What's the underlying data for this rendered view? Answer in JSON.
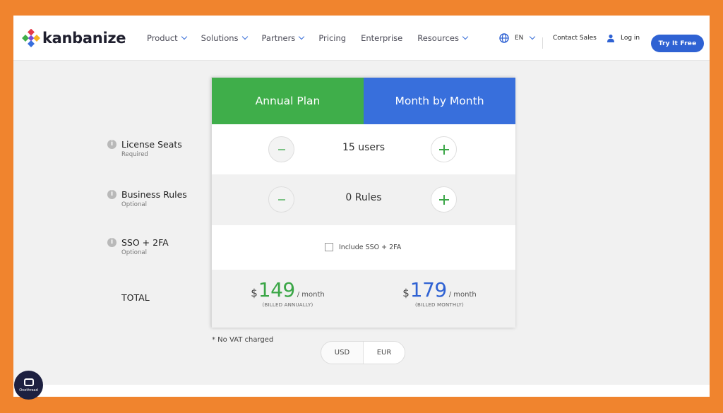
{
  "nav": {
    "logo_text": "kanbanize",
    "menu": [
      {
        "label": "Product",
        "dropdown": true
      },
      {
        "label": "Solutions",
        "dropdown": true
      },
      {
        "label": "Partners",
        "dropdown": true
      },
      {
        "label": "Pricing",
        "dropdown": false
      },
      {
        "label": "Enterprise",
        "dropdown": false
      },
      {
        "label": "Resources",
        "dropdown": true
      }
    ],
    "language": "EN",
    "contact_sales": "Contact Sales",
    "login": "Log in",
    "try_free": "Try It Free"
  },
  "pricing": {
    "tabs": {
      "annual": "Annual Plan",
      "monthly": "Month by Month"
    },
    "license_seats": {
      "title": "License Seats",
      "subtitle": "Required",
      "value": "15 users"
    },
    "business_rules": {
      "title": "Business Rules",
      "subtitle": "Optional",
      "value": "0 Rules"
    },
    "sso": {
      "title": "SSO + 2FA",
      "subtitle": "Optional",
      "checkbox_label": "Include SSO + 2FA",
      "checked": false
    },
    "total": {
      "label": "TOTAL",
      "currency_symbol": "$",
      "annual_amount": "149",
      "monthly_amount": "179",
      "per_month": "/ month",
      "annual_billing": "(BILLED ANNUALLY)",
      "monthly_billing": "(BILLED MONTHLY)"
    },
    "vat_note": "* No VAT charged",
    "currencies": [
      "USD",
      "EUR"
    ],
    "selected_currency": "EUR"
  },
  "badge": {
    "text": "Onethread"
  },
  "colors": {
    "frame": "#F0842E",
    "annual_tab": "#3fae4a",
    "monthly_tab": "#386fdc",
    "primary_button": "#2f62d3",
    "plus_green": "#3aa646"
  }
}
